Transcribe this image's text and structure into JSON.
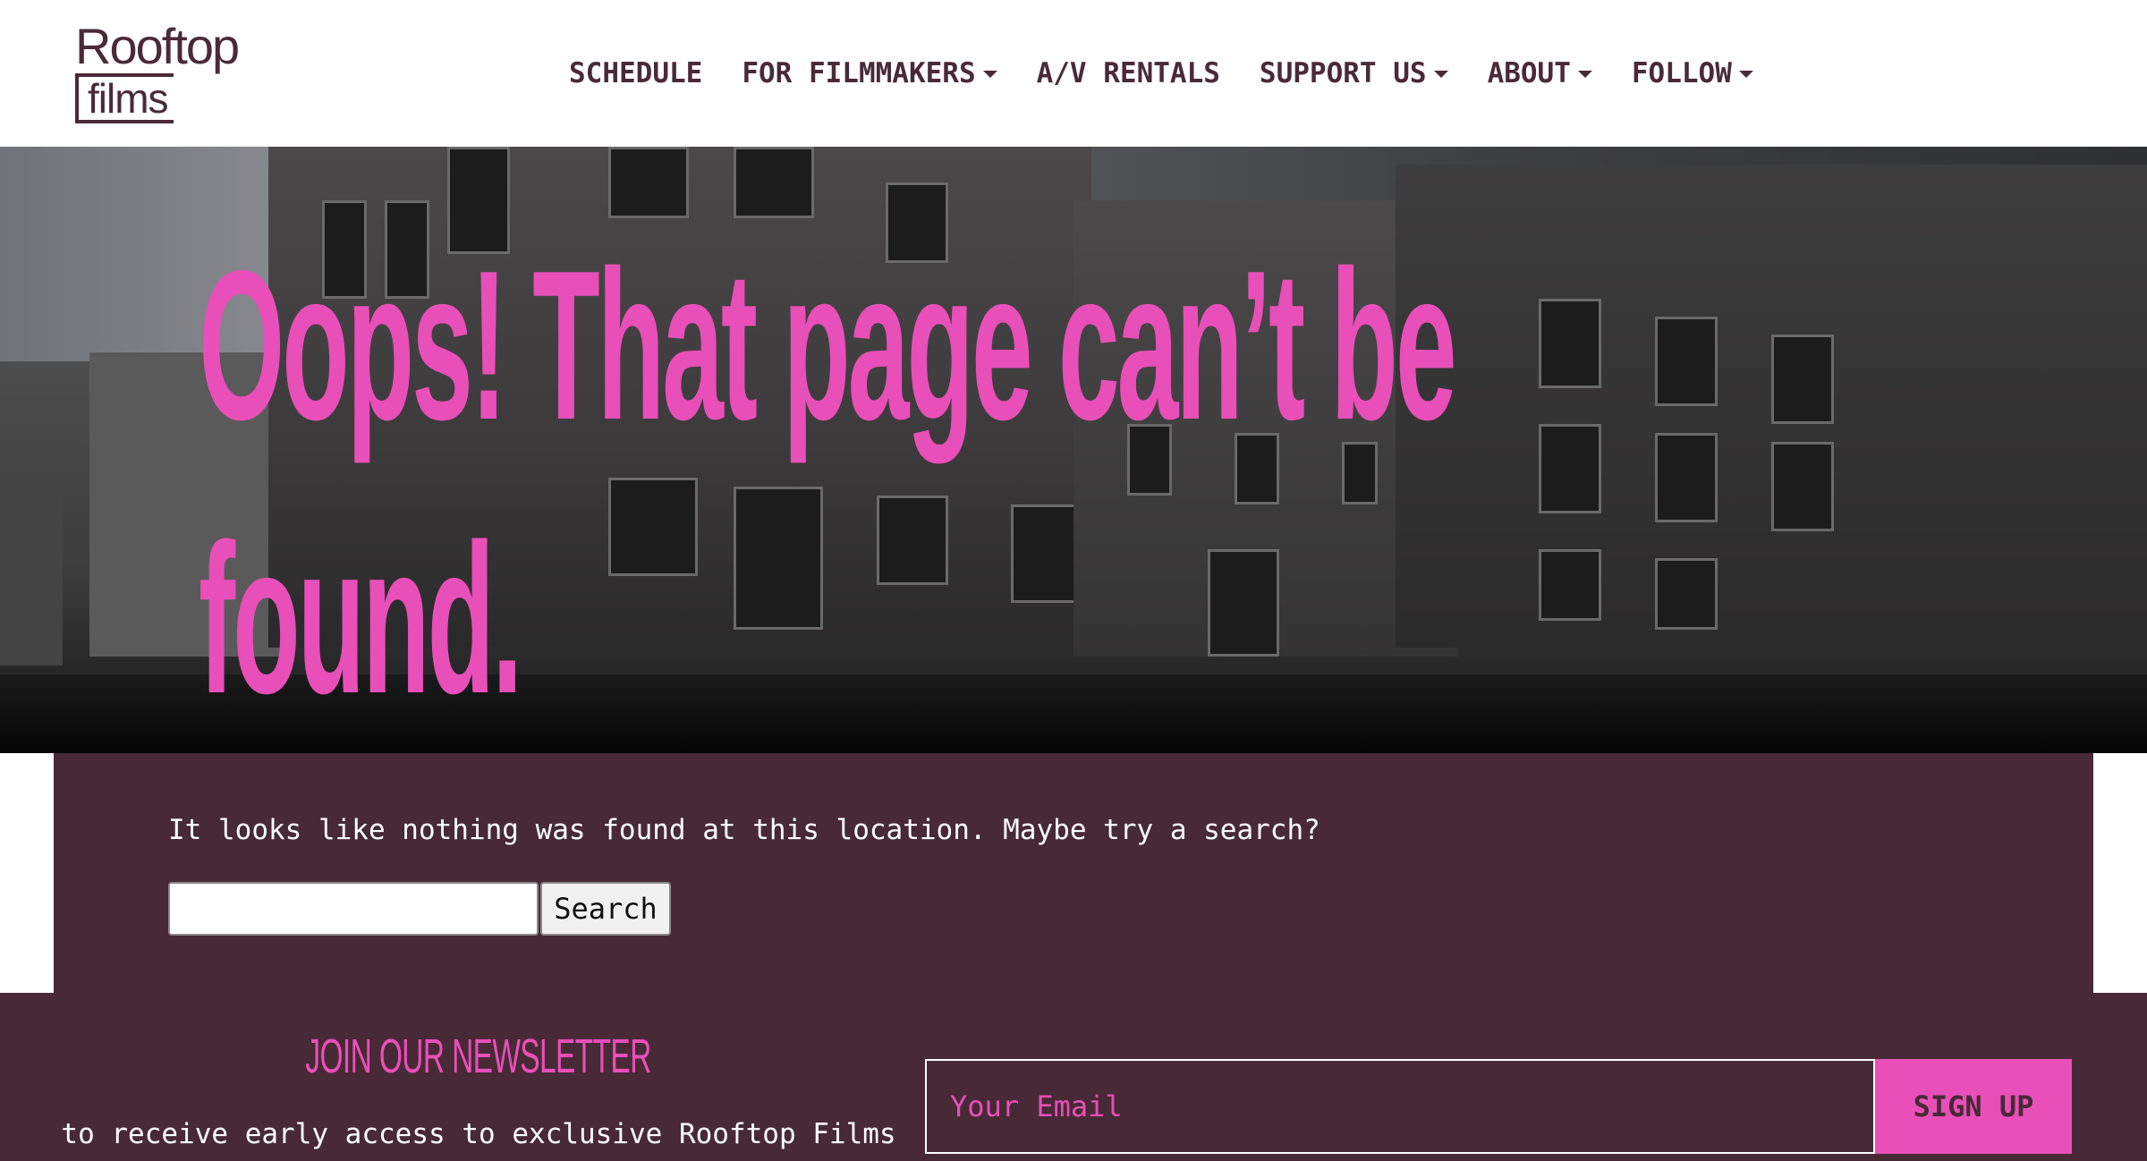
{
  "header": {
    "logo": {
      "line1": "Rooftop",
      "line2": "films"
    },
    "nav": [
      {
        "label": "SCHEDULE",
        "dropdown": false
      },
      {
        "label": "FOR FILMMAKERS",
        "dropdown": true
      },
      {
        "label": "A/V RENTALS",
        "dropdown": false
      },
      {
        "label": "SUPPORT US",
        "dropdown": true
      },
      {
        "label": "ABOUT",
        "dropdown": true
      },
      {
        "label": "FOLLOW",
        "dropdown": true
      }
    ]
  },
  "hero": {
    "title": "Oops! That page can’t be found."
  },
  "content": {
    "message": "It looks like nothing was found at this location. Maybe try a search?",
    "search": {
      "value": "",
      "button_label": "Search"
    }
  },
  "newsletter": {
    "title": "JOIN OUR NEWSLETTER",
    "subtitle": "to receive early access to exclusive Rooftop Films Content",
    "email_placeholder": "Your Email",
    "signup_label": "SIGN UP"
  },
  "colors": {
    "brand_plum": "#482a37",
    "accent_pink": "#e84fb8",
    "nav_text": "#4a2a38"
  }
}
